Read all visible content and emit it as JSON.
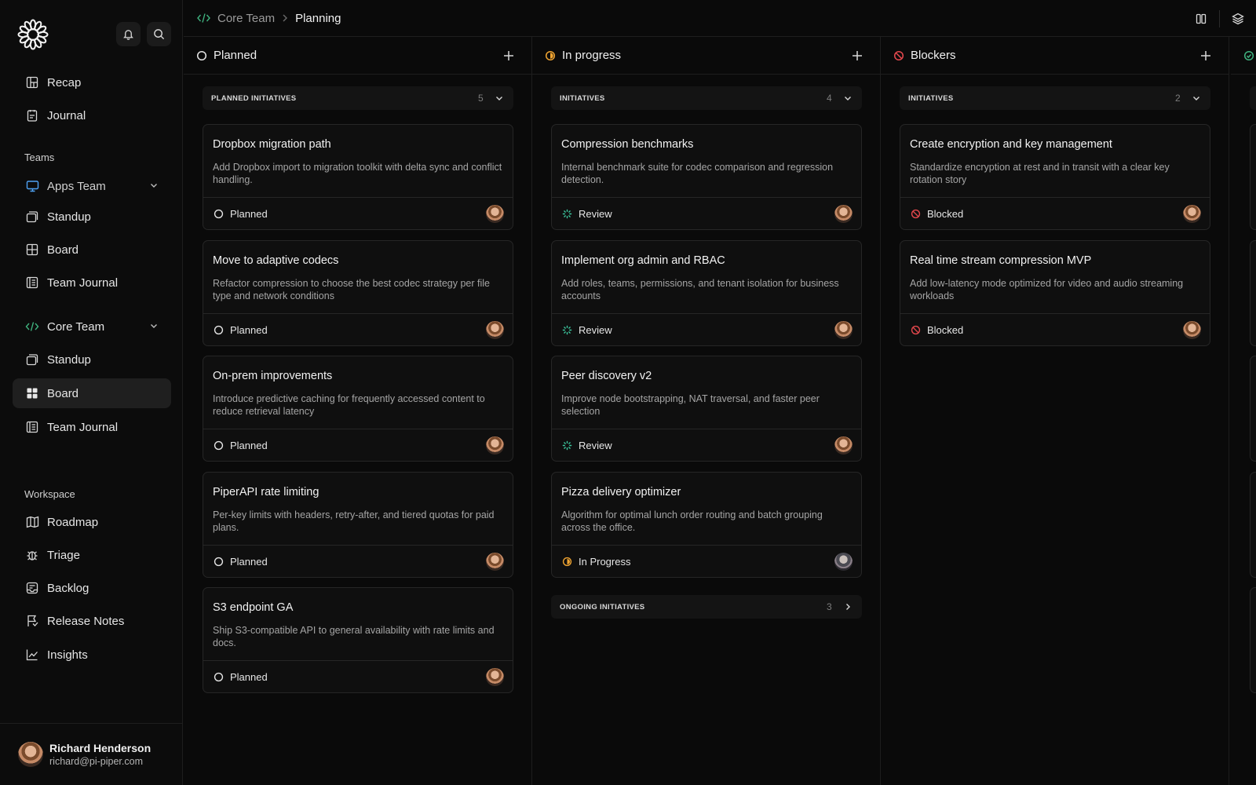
{
  "colors": {
    "accent_green": "#3fb27f",
    "planned": "#e6e6e6",
    "in_progress": "#f0a431",
    "blocked": "#e5484d",
    "review": "#3cc9a0",
    "app_blue": "#4ea1f3"
  },
  "sidebar": {
    "logo": "flower-logo",
    "nav_top": [
      {
        "label": "Recap",
        "icon": "recap-icon"
      },
      {
        "label": "Journal",
        "icon": "journal-icon"
      }
    ],
    "teams_label": "Teams",
    "apps_team": {
      "label": "Apps Team",
      "items": [
        {
          "label": "Standup"
        },
        {
          "label": "Board"
        },
        {
          "label": "Team Journal"
        }
      ]
    },
    "core_team": {
      "label": "Core Team",
      "items": [
        {
          "label": "Standup"
        },
        {
          "label": "Board"
        },
        {
          "label": "Team Journal"
        }
      ]
    },
    "workspace_label": "Workspace",
    "workspace_items": [
      {
        "label": "Roadmap"
      },
      {
        "label": "Triage"
      },
      {
        "label": "Backlog"
      },
      {
        "label": "Release Notes"
      },
      {
        "label": "Insights"
      }
    ],
    "user": {
      "name": "Richard Henderson",
      "email": "richard@pi-piper.com"
    }
  },
  "topbar": {
    "breadcrumb_parent": "Core Team",
    "breadcrumb_current": "Planning"
  },
  "columns": [
    {
      "title": "Planned",
      "groups": [
        {
          "label": "PLANNED INITIATIVES",
          "count": "5"
        }
      ],
      "cards": [
        {
          "title": "Dropbox migration path",
          "desc": "Add Dropbox import to migration toolkit with delta sync and conflict handling.",
          "status": "Planned"
        },
        {
          "title": "Move to adaptive codecs",
          "desc": "Refactor compression to choose the best codec strategy per file type and network conditions",
          "status": "Planned"
        },
        {
          "title": "On-prem improvements",
          "desc": "Introduce predictive caching for frequently accessed content to reduce retrieval latency",
          "status": "Planned"
        },
        {
          "title": "PiperAPI rate limiting",
          "desc": "Per-key limits with headers, retry-after, and tiered quotas for paid plans.",
          "status": "Planned"
        },
        {
          "title": "S3 endpoint GA",
          "desc": "Ship S3-compatible API to general availability with rate limits and docs.",
          "status": "Planned"
        }
      ]
    },
    {
      "title": "In progress",
      "groups": [
        {
          "label": "INITIATIVES",
          "count": "4"
        },
        {
          "label": "ONGOING INITIATIVES",
          "count": "3"
        }
      ],
      "cards": [
        {
          "title": "Compression benchmarks",
          "desc": "Internal benchmark suite for codec comparison and regression detection.",
          "status": "Review"
        },
        {
          "title": "Implement org admin and RBAC",
          "desc": "Add roles, teams, permissions, and tenant isolation for business accounts",
          "status": "Review"
        },
        {
          "title": "Peer discovery v2",
          "desc": "Improve node bootstrapping, NAT traversal, and faster peer selection",
          "status": "Review"
        },
        {
          "title": "Pizza delivery optimizer",
          "desc": "Algorithm for optimal lunch order routing and batch grouping across the office.",
          "status": "In Progress"
        }
      ]
    },
    {
      "title": "Blockers",
      "groups": [
        {
          "label": "INITIATIVES",
          "count": "2"
        }
      ],
      "cards": [
        {
          "title": "Create encryption and key management",
          "desc": "Standardize encryption at rest and in transit with a clear key rotation story",
          "status": "Blocked"
        },
        {
          "title": "Real time stream compression MVP",
          "desc": "Add low-latency mode optimized for video and audio streaming workloads",
          "status": "Blocked"
        }
      ]
    }
  ]
}
